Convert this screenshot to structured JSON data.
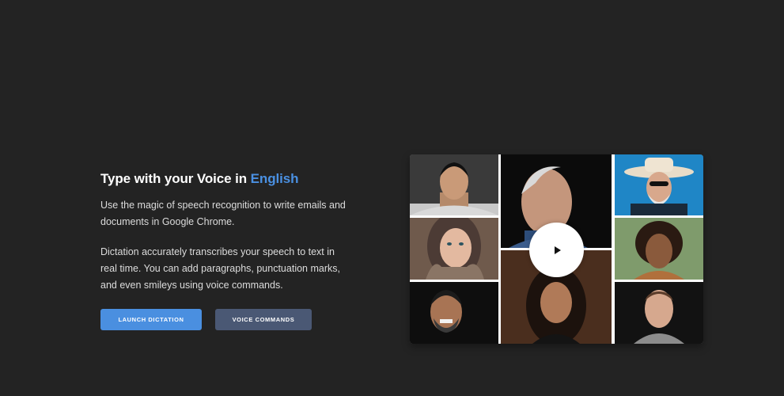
{
  "hero": {
    "title_prefix": "Type with your Voice in ",
    "title_language": "English",
    "paragraph_1": "Use the magic of speech recognition to write emails and documents in Google Chrome.",
    "paragraph_2": "Dictation accurately transcribes your speech to text in real time. You can add paragraphs, punctuation marks, and even smileys using voice commands."
  },
  "actions": {
    "launch_label": "LAUNCH DICTATION",
    "commands_label": "VOICE COMMANDS"
  },
  "video": {
    "play_icon": "play-icon"
  },
  "colors": {
    "background": "#232323",
    "accent": "#4a90e2",
    "primary_button": "#4a8fe0",
    "secondary_button": "#4a5874"
  }
}
